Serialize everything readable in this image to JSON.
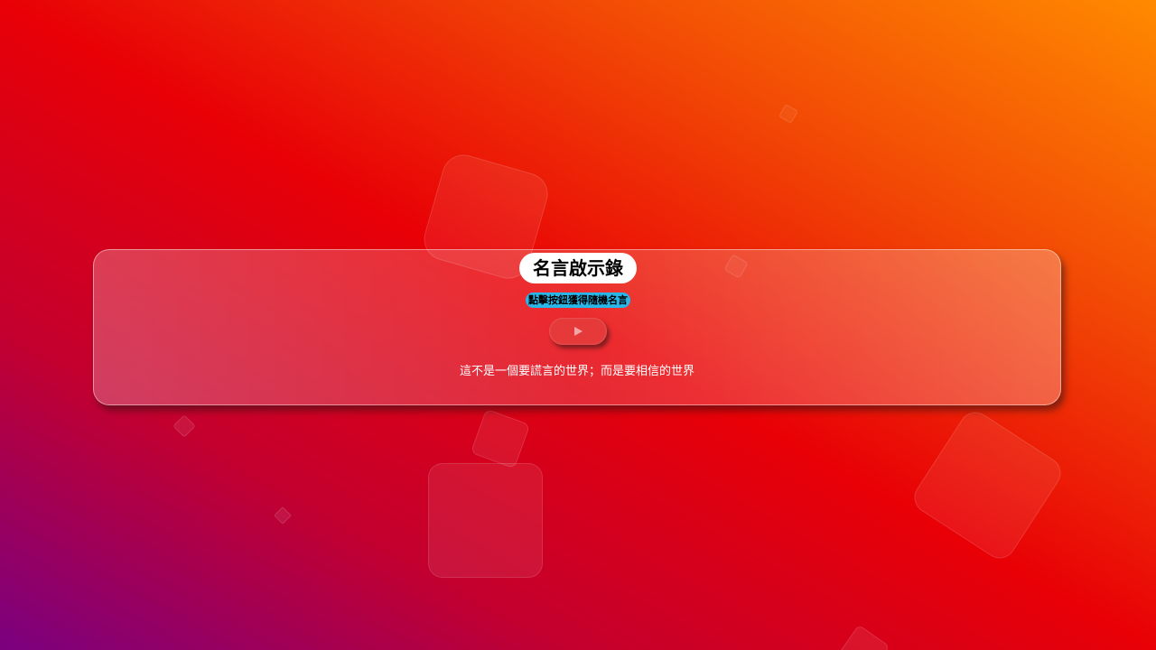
{
  "app": {
    "title": "名言啟示錄",
    "subtitle": "點擊按鈕獲得隨機名言",
    "quote": "這不是一個要謊言的世界；而是要相信的世界"
  },
  "play_button": {
    "icon": "play-icon"
  },
  "colors": {
    "title_background": "#ffffff",
    "subtitle_background": "#29b6e8",
    "button_background": "#e63a3a",
    "quote_text": "#ffffff"
  }
}
